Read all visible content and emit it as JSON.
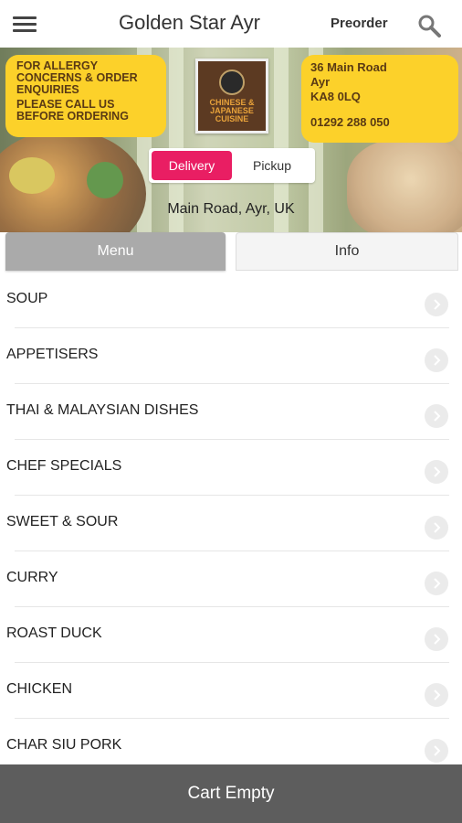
{
  "header": {
    "title": "Golden Star Ayr",
    "preorder_label": "Preorder",
    "menu_icon": "hamburger-icon",
    "search_icon": "search-icon"
  },
  "hero": {
    "notice_lines": [
      "FOR ALLERGY",
      "CONCERNS & ORDER",
      "ENQUIRIES",
      "PLEASE CALL US",
      "BEFORE ORDERING"
    ],
    "address_lines": [
      "36 Main Road",
      "Ayr",
      "KA8 0LQ"
    ],
    "phone": "01292 288 050",
    "logo_text_lines": [
      "CHINESE &",
      "JAPANESE",
      "CUISINE"
    ],
    "delivery_label": "Delivery",
    "pickup_label": "Pickup",
    "selected_mode": "Delivery",
    "location": "Main Road, Ayr, UK",
    "accent_color": "#e91e63",
    "notice_color": "#fcd12a"
  },
  "tabs": {
    "menu_label": "Menu",
    "info_label": "Info",
    "active": "Menu"
  },
  "categories": [
    "SOUP",
    "APPETISERS",
    "THAI & MALAYSIAN DISHES",
    "CHEF SPECIALS",
    "SWEET & SOUR",
    "CURRY",
    "ROAST DUCK",
    "CHICKEN",
    "CHAR SIU PORK"
  ],
  "cart": {
    "label": "Cart Empty"
  }
}
